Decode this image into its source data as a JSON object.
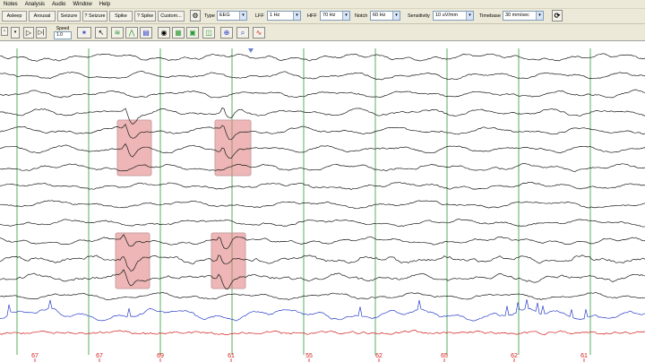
{
  "menu": [
    "Notes",
    "Analysis",
    "Audio",
    "Window",
    "Help"
  ],
  "event_buttons": [
    "Asleep",
    "Arousal",
    "Seizure",
    "? Seizure",
    "Spike",
    "? Spike",
    "Custom..."
  ],
  "filters": {
    "type_label": "Type",
    "type_value": "EEG",
    "lff_label": "LFF",
    "lff_value": "1 Hz",
    "hff_label": "HFF",
    "hff_value": "70 Hz",
    "notch_label": "Notch",
    "notch_value": "60 Hz",
    "sensitivity_label": "Sensitivity",
    "sensitivity_value": "10 uV/mm",
    "timebase_label": "Timebase",
    "timebase_value": "30 mm/sec"
  },
  "speed": {
    "label": "Speed",
    "value": "1.0"
  },
  "icons": {
    "refresh": "refresh-icon",
    "settings": "settings-icon",
    "play": "play-icon",
    "step": "step-icon",
    "marker": "marker-icon",
    "montage": "montage-icon",
    "zoom": "zoom-icon"
  },
  "colors": {
    "trace_black": "#1a1a1a",
    "trace_blue": "#2b3fc8",
    "trace_red": "#d21a1a",
    "second_lines": "#2e9b3a",
    "highlight": "#e07a7a"
  },
  "ruler_labels": [
    "67",
    "67",
    "69",
    "61",
    "55",
    "62",
    "65",
    "62",
    "61"
  ],
  "channel_count": 16
}
